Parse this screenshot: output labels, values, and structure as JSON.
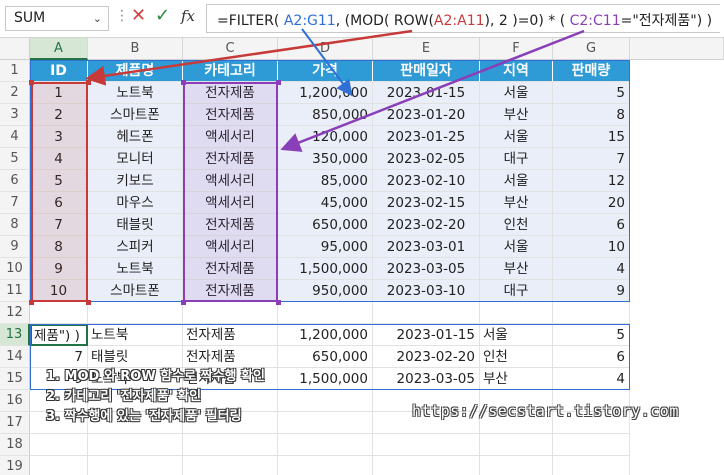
{
  "formula_bar": {
    "name_box": "SUM",
    "fx_label": "fx",
    "formula_parts": [
      "=FILTER( ",
      "A2:G11",
      ", (MOD( ROW(",
      "A2:A11",
      "), 2 )=0) * ( ",
      "C2:C11",
      "=\"전자제품\") )"
    ]
  },
  "columns": [
    "A",
    "B",
    "C",
    "D",
    "E",
    "F",
    "G"
  ],
  "rows": [
    "1",
    "2",
    "3",
    "4",
    "5",
    "6",
    "7",
    "8",
    "9",
    "10",
    "11",
    "12",
    "13",
    "14",
    "15",
    "16",
    "17",
    "18",
    "19"
  ],
  "table": {
    "headers": [
      "ID",
      "제품명",
      "카테고리",
      "가격",
      "판매일자",
      "지역",
      "판매량"
    ],
    "data": [
      [
        "1",
        "노트북",
        "전자제품",
        "1,200,000",
        "2023-01-15",
        "서울",
        "5"
      ],
      [
        "2",
        "스마트폰",
        "전자제품",
        "850,000",
        "2023-01-20",
        "부산",
        "8"
      ],
      [
        "3",
        "헤드폰",
        "액세서리",
        "120,000",
        "2023-01-25",
        "서울",
        "15"
      ],
      [
        "4",
        "모니터",
        "전자제품",
        "350,000",
        "2023-02-05",
        "대구",
        "7"
      ],
      [
        "5",
        "키보드",
        "액세서리",
        "85,000",
        "2023-02-10",
        "서울",
        "12"
      ],
      [
        "6",
        "마우스",
        "액세서리",
        "45,000",
        "2023-02-15",
        "부산",
        "20"
      ],
      [
        "7",
        "태블릿",
        "전자제품",
        "650,000",
        "2023-02-20",
        "인천",
        "6"
      ],
      [
        "8",
        "스피커",
        "액세서리",
        "95,000",
        "2023-03-01",
        "서울",
        "10"
      ],
      [
        "9",
        "노트북",
        "전자제품",
        "1,500,000",
        "2023-03-05",
        "부산",
        "4"
      ],
      [
        "10",
        "스마트폰",
        "전자제품",
        "950,000",
        "2023-03-10",
        "대구",
        "9"
      ]
    ]
  },
  "result": {
    "active_cell_text": "제품\") )",
    "rows": [
      [
        "",
        "노트북",
        "전자제품",
        "1,200,000",
        "2023-01-15",
        "서울",
        "5"
      ],
      [
        "7",
        "태블릿",
        "전자제품",
        "650,000",
        "2023-02-20",
        "인천",
        "6"
      ],
      [
        "9",
        "노트북",
        "전자제품",
        "1,500,000",
        "2023-03-05",
        "부산",
        "4"
      ]
    ]
  },
  "notes": [
    "1. MOD 와 ROW 함수로 짝수행 확인",
    "2. 카테고리 '전자제품' 확인",
    "3. 짝수행에 있는 '전자제품' 필터링"
  ],
  "watermark": "https://secstart.tistory.com",
  "colors": {
    "header_blue": "#2e9ad6",
    "band": "#e9eef8",
    "range_red": "#c83a3a",
    "range_purple": "#8a3fb8",
    "range_blue": "#2f6fd6",
    "excel_green": "#217346"
  }
}
